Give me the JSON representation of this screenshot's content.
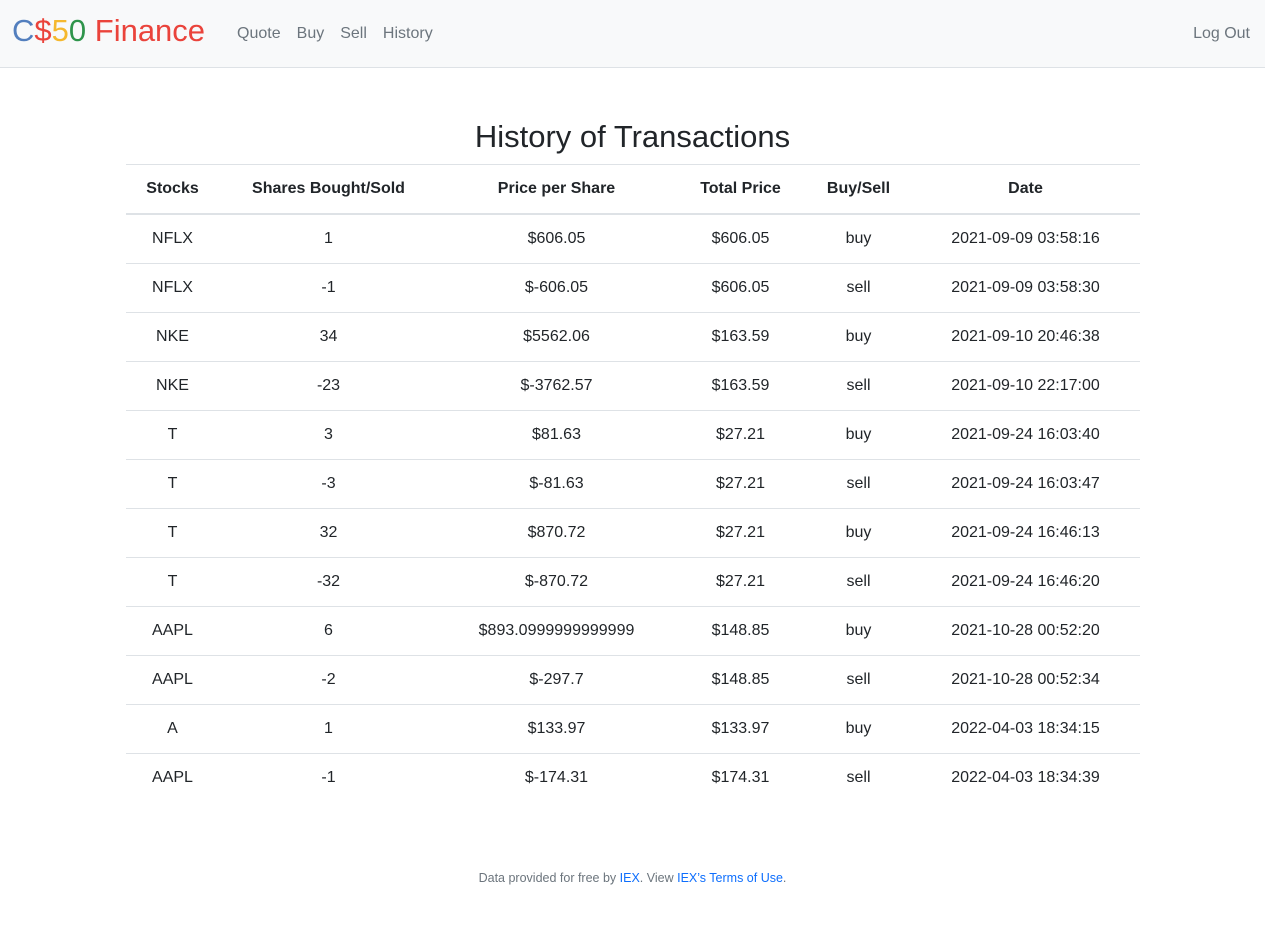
{
  "brand": {
    "parts": [
      {
        "text": "C",
        "color": "#537fbe"
      },
      {
        "text": "$",
        "color": "#ea433b"
      },
      {
        "text": "5",
        "color": "#f5b82e"
      },
      {
        "text": "0",
        "color": "#2e944b"
      },
      {
        "text": " Finance",
        "color": "#ea433b"
      }
    ]
  },
  "nav": {
    "quote": "Quote",
    "buy": "Buy",
    "sell": "Sell",
    "history": "History",
    "logout": "Log Out"
  },
  "page": {
    "title": "History of Transactions"
  },
  "table": {
    "headers": [
      "Stocks",
      "Shares Bought/Sold",
      "Price per Share",
      "Total Price",
      "Buy/Sell",
      "Date"
    ],
    "rows": [
      [
        "NFLX",
        "1",
        "$606.05",
        "$606.05",
        "buy",
        "2021-09-09 03:58:16"
      ],
      [
        "NFLX",
        "-1",
        "$-606.05",
        "$606.05",
        "sell",
        "2021-09-09 03:58:30"
      ],
      [
        "NKE",
        "34",
        "$5562.06",
        "$163.59",
        "buy",
        "2021-09-10 20:46:38"
      ],
      [
        "NKE",
        "-23",
        "$-3762.57",
        "$163.59",
        "sell",
        "2021-09-10 22:17:00"
      ],
      [
        "T",
        "3",
        "$81.63",
        "$27.21",
        "buy",
        "2021-09-24 16:03:40"
      ],
      [
        "T",
        "-3",
        "$-81.63",
        "$27.21",
        "sell",
        "2021-09-24 16:03:47"
      ],
      [
        "T",
        "32",
        "$870.72",
        "$27.21",
        "buy",
        "2021-09-24 16:46:13"
      ],
      [
        "T",
        "-32",
        "$-870.72",
        "$27.21",
        "sell",
        "2021-09-24 16:46:20"
      ],
      [
        "AAPL",
        "6",
        "$893.0999999999999",
        "$148.85",
        "buy",
        "2021-10-28 00:52:20"
      ],
      [
        "AAPL",
        "-2",
        "$-297.7",
        "$148.85",
        "sell",
        "2021-10-28 00:52:34"
      ],
      [
        "A",
        "1",
        "$133.97",
        "$133.97",
        "buy",
        "2022-04-03 18:34:15"
      ],
      [
        "AAPL",
        "-1",
        "$-174.31",
        "$174.31",
        "sell",
        "2022-04-03 18:34:39"
      ]
    ]
  },
  "footer": {
    "prefix": "Data provided for free by ",
    "iex_link": "IEX",
    "middle": ". View ",
    "terms_link": "IEX’s Terms of Use",
    "suffix": "."
  }
}
